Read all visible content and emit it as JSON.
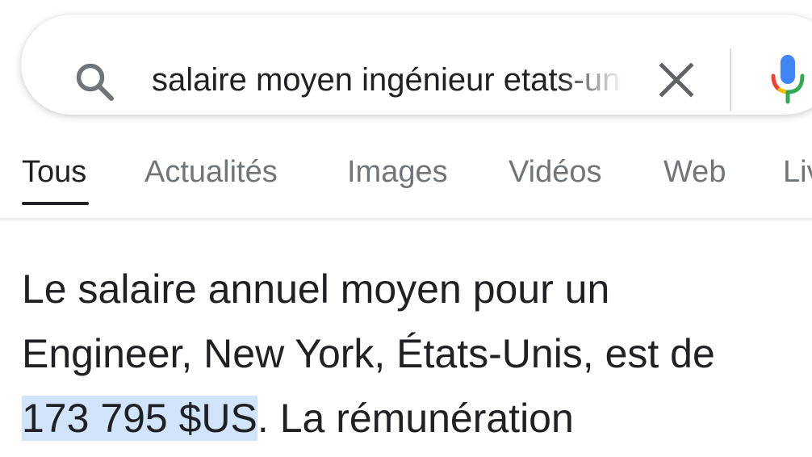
{
  "search": {
    "query": "salaire moyen ingénieur etats-unis",
    "icons": {
      "search": "search-icon",
      "clear": "close-icon",
      "voice": "microphone-icon"
    }
  },
  "tabs": [
    {
      "label": "Tous",
      "active": true
    },
    {
      "label": "Actualités",
      "active": false
    },
    {
      "label": "Images",
      "active": false
    },
    {
      "label": "Vidéos",
      "active": false
    },
    {
      "label": "Web",
      "active": false
    },
    {
      "label": "Livres",
      "active": false
    }
  ],
  "snippet": {
    "line1": "Le salaire annuel moyen pour un",
    "line2": "Engineer, New York, États-Unis, est de",
    "highlight": "173 795 $US",
    "line3_rest": ". La rémunération"
  },
  "colors": {
    "text_primary": "#202124",
    "text_secondary": "#70757a",
    "highlight_bg": "#d2e3fc",
    "google_blue": "#4285f4",
    "google_red": "#ea4335",
    "google_yellow": "#fbbc05",
    "google_green": "#34a853"
  }
}
